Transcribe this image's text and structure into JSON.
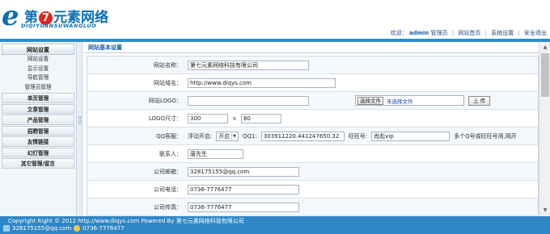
{
  "brand": {
    "logo_letter": "e",
    "name_pre": "第",
    "name_seven": "7",
    "name_post": "元素网络",
    "pinyin": "DIQIYUANSUWANGLUO"
  },
  "topnav": {
    "welcome": "欢迎：",
    "user": "admin",
    "role": "管理员",
    "links": [
      "网站首页",
      "系统设置",
      "安全退出"
    ]
  },
  "sidebar": {
    "section_head": "网站设置",
    "sub_items": [
      "网站设置",
      "显示设置",
      "导航管理",
      "管理员管理"
    ],
    "sections": [
      "单页管理",
      "文章管理",
      "产品管理",
      "招聘管理",
      "友情链接",
      "幻灯管理",
      "其它管理/留言"
    ]
  },
  "main": {
    "panel_title": "网站基本设置",
    "rows": {
      "site_name": {
        "label": "网站名称：",
        "value": "第七元素网络科技有限公司"
      },
      "site_domain": {
        "label": "网站域名：",
        "value": "http://www.diqys.com"
      },
      "site_logo": {
        "label": "网站LOGO：",
        "value": "",
        "choose_label": "选择文件",
        "no_file": "未选择文件",
        "upload_label": "上 传"
      },
      "logo_size": {
        "label": "LOGO尺寸：",
        "width": "300",
        "times": "×",
        "height": "80"
      },
      "qq": {
        "label": "QQ客服：",
        "float_label": "浮动开启:",
        "float_value": "开启",
        "qq_label": "QQ1:",
        "qq_value": "303911220.441247650.32",
        "ww_label": "旺旺号:",
        "ww_value": "肖彪vip",
        "hint": "多个Q号或旺旺号用,隔开"
      },
      "contact": {
        "label": "联系人：",
        "value": "唐先生"
      },
      "email": {
        "label": "公司邮箱：",
        "value": "328175155@qq.com"
      },
      "phone": {
        "label": "公司电话：",
        "value": "0736-7776477"
      },
      "fax": {
        "label": "公司传真：",
        "value": "0736-7776477"
      }
    }
  },
  "footer": {
    "copyright": "Copyright Right © 2012 http://www.diqys.com Powered By 第七元素网络科技有限公司",
    "email": "328175155@qq.com",
    "phone": "0736-7776477"
  }
}
